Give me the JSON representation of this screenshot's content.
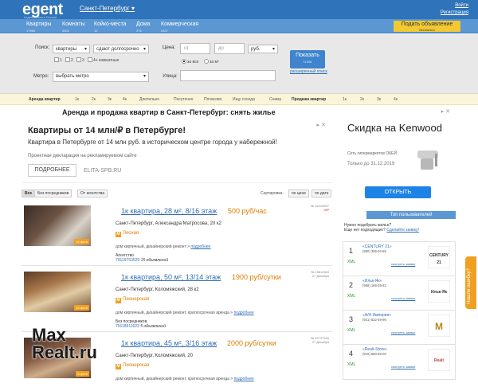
{
  "header": {
    "logo": "egent",
    "logo_sub": "недвижимость России",
    "city": "Санкт-Петербург",
    "login": "Войти",
    "register": "Регистрация"
  },
  "nav": {
    "items": [
      {
        "label": "Квартиры",
        "count": "17956"
      },
      {
        "label": "Комнаты",
        "count": "4402"
      },
      {
        "label": "Койко-места",
        "count": "12"
      },
      {
        "label": "Дома",
        "count": "276"
      },
      {
        "label": "Коммерческая",
        "count": "2847"
      }
    ],
    "post_ad": "Подать объявление",
    "post_ad_sub": "бесплатно"
  },
  "search": {
    "search_label": "Поиск:",
    "type_value": "квартиры",
    "term_value": "сдают долгосрочно",
    "rooms": [
      "1",
      "2",
      "3"
    ],
    "rooms_more": "4+ комнатные",
    "price_label": "Цена:",
    "price_from": "от",
    "price_to": "до",
    "currency": "руб.",
    "price_all": "за все",
    "price_m2": "за м²",
    "metro_label": "Метро:",
    "metro_value": "выбрать метро",
    "street_label": "Улица:",
    "show_button": "Показать",
    "show_count": "11906",
    "extended": "расширенный поиск"
  },
  "quick_links": {
    "rent_label": "Аренда квартир",
    "rent": [
      "1к",
      "2к",
      "3к",
      "4к",
      "Длительно",
      "Посуточно",
      "Почасово",
      "Ищу соседа",
      "Сниму"
    ],
    "sale_label": "Продажа квартир",
    "sale": [
      "1к",
      "2к",
      "3к",
      "4к"
    ]
  },
  "page": {
    "title": "Аренда и продажа квартир в Санкт-Петербург: снять жилье"
  },
  "ad_main": {
    "title": "Квартиры от 14 млн/₽ в Петербурге!",
    "text": "Квартира в Петербурге от 14 млн руб. в историческом центре города у набережной!",
    "note": "Проектная декларация на рекламируемом сайте",
    "button": "ПОДРОБНЕЕ",
    "url": "ELITA-SPB.RU"
  },
  "ad_side": {
    "title": "Скидка на Kenwood",
    "note": "Сеть гипермаркетов ОКЕЙ",
    "date": "Только до 31.12.2019",
    "button": "ОТКРЫТЬ"
  },
  "filters": {
    "all": "Все",
    "no_broker": "Без посредников",
    "agency": "От агентства",
    "sort_label": "Сортировка:",
    "sort_price": "по цене",
    "sort_date": "по дате"
  },
  "listings": [
    {
      "title": "1к квартира, 28 м², 8/16 этаж",
      "price": "500 руб/час",
      "id": "№ 16244597",
      "badge": "VIP",
      "address": "Санкт-Петербург, Александра Матросова, 20 к2",
      "metro": "Лесная",
      "desc": "дом кирпичный, дизайнерский ремонт",
      "more": "подробнее",
      "agent_type": "Агентство",
      "agent_phone": "79119753529",
      "agent_ads": "15 объявлений",
      "photos": "15 фото"
    },
    {
      "title": "1к квартира, 50 м², 13/14 этаж",
      "price": "1900 руб/сутки",
      "id": "№ 15811563",
      "badge": "27 Декабря",
      "address": "Санкт-Петербург, Коломяжский, 28 к2",
      "metro": "Пионерская",
      "desc": "дом кирпичный, дизайнерский ремонт, краткосрочная аренда",
      "more": "подробнее",
      "agent_type": "Без посредников",
      "agent_phone": "79118911622",
      "agent_ads": "5 объявлений",
      "photos": "10 фото"
    },
    {
      "title": "1к квартира, 45 м², 3/16 этаж",
      "price": "2000 руб/сутки",
      "id": "№ 15737535",
      "badge": "27 Декабря",
      "address": "Санкт-Петербург, Коломяжский, 20",
      "metro": "Пионерская",
      "desc": "дом кирпичный, дизайнерский ремонт, краткосрочная аренда",
      "more": "подробнее",
      "agent_type": "",
      "agent_phone": "",
      "agent_ads": "",
      "photos": "5 фото"
    }
  ],
  "users": {
    "heading": "Топ пользователей",
    "question": "Нужно подобрать жилье?",
    "question2": "Еще нет подходящих?",
    "question_link": "Сделайте заявку!",
    "items": [
      {
        "num": "1",
        "name": "«CENTURY 21»",
        "phone": "(950) 306-02-65",
        "link": "смотреть заявки",
        "logo": "CENTURY 21"
      },
      {
        "num": "2",
        "name": "«Ильк-Як»",
        "phone": "(968) 185-35-62",
        "link": "смотреть заявки",
        "logo": "Ильк-Як"
      },
      {
        "num": "3",
        "name": "«А/Н Империя»",
        "phone": "(921) 622-49-96",
        "link": "смотреть заявки",
        "logo": "М"
      },
      {
        "num": "4",
        "name": "«Realt-Store»",
        "phone": "(916) 560-65-00",
        "link": "смотреть заявки",
        "logo": "Realt"
      }
    ],
    "xml": "XML"
  },
  "side_tab": "Нашли ошибку?",
  "watermark": {
    "line1": "Max",
    "line2": "Realt.ru"
  }
}
